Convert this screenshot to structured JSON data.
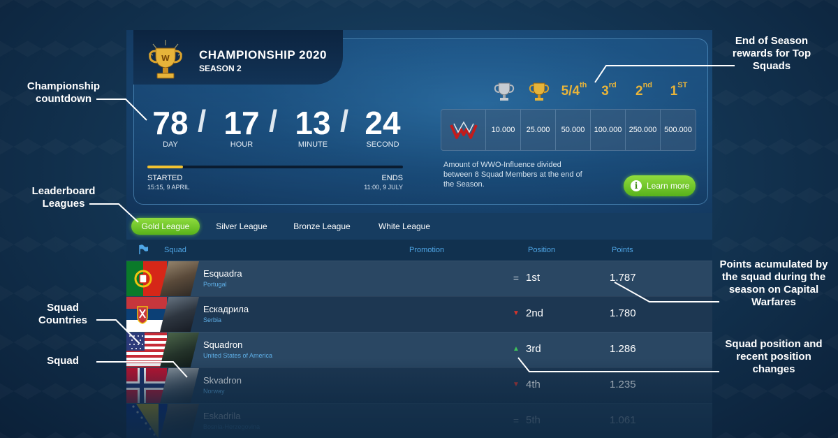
{
  "annotations": {
    "countdown": "Championship countdown",
    "leagues": "Leaderboard Leagues",
    "countries": "Squad Countries",
    "squad": "Squad",
    "rewards": "End of Season rewards for Top Squads",
    "points": "Points acumulated by the squad during the season on Capital Warfares",
    "position": "Squad position and recent position changes"
  },
  "header": {
    "title": "CHAMPIONSHIP 2020",
    "season": "SEASON 2"
  },
  "countdown": {
    "days": "78",
    "hours": "17",
    "minutes": "13",
    "seconds": "24",
    "sep": "/",
    "days_label": "DAY",
    "hours_label": "HOUR",
    "minutes_label": "MINUTE",
    "seconds_label": "SECOND",
    "progress": 0.14,
    "started_label": "STARTED",
    "started_date": "15:15, 9 APRIL",
    "ends_label": "ENDS",
    "ends_date": "11:00, 9 JULY"
  },
  "rewards": {
    "ranks": [
      {
        "type": "icon",
        "icon": "silver-trophy-icon"
      },
      {
        "type": "icon",
        "icon": "gold-trophy-icon"
      },
      {
        "type": "text",
        "main": "5/4",
        "sup": "th"
      },
      {
        "type": "text",
        "main": "3",
        "sup": "rd"
      },
      {
        "type": "text",
        "main": "2",
        "sup": "nd"
      },
      {
        "type": "text",
        "main": "1",
        "sup": "ST"
      }
    ],
    "amounts": [
      "10.000",
      "25.000",
      "50.000",
      "100.000",
      "250.000",
      "500.000"
    ],
    "description": "Amount of WWO-Influence divided between 8 Squad Members at the end of the Season.",
    "learn_more": "Learn more",
    "info_glyph": "i"
  },
  "leagues": [
    {
      "label": "Gold League",
      "active": true
    },
    {
      "label": "Silver League",
      "active": false
    },
    {
      "label": "Bronze League",
      "active": false
    },
    {
      "label": "White League",
      "active": false
    }
  ],
  "table": {
    "headers": {
      "squad": "Squad",
      "promotion": "Promotion",
      "position": "Position",
      "points": "Points"
    },
    "rows": [
      {
        "name": "Esquadra",
        "country": "Portugal",
        "trend": "same",
        "trend_glyph": "=",
        "position": "1st",
        "points": "1.787"
      },
      {
        "name": "Ескадрила",
        "country": "Serbia",
        "trend": "down",
        "trend_glyph": "▼",
        "position": "2nd",
        "points": "1.780"
      },
      {
        "name": "Squadron",
        "country": "United States of America",
        "trend": "up",
        "trend_glyph": "▲",
        "position": "3rd",
        "points": "1.286"
      },
      {
        "name": "Skvadron",
        "country": "Norway",
        "trend": "down",
        "trend_glyph": "▼",
        "position": "4th",
        "points": "1.235"
      },
      {
        "name": "Eskadrila",
        "country": "Bosnia-Herzegovina",
        "trend": "same",
        "trend_glyph": "=",
        "position": "5th",
        "points": "1.061"
      }
    ]
  },
  "colors": {
    "accent_green": "#6cc62a",
    "gold": "#e8b43a",
    "link_blue": "#4fa6e6",
    "trend_up": "#3fc35a",
    "trend_down": "#d9342b"
  }
}
